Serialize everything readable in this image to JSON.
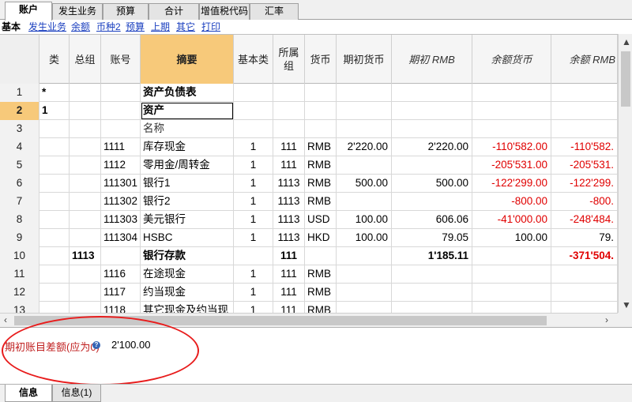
{
  "tabs": [
    "账户",
    "发生业务",
    "预算",
    "合计",
    "增值税代码",
    "汇率"
  ],
  "subnav": {
    "current": "基本",
    "links": [
      "发生业务",
      "余额",
      "币种2",
      "预算",
      "上期",
      "其它",
      "打印"
    ]
  },
  "columns": [
    "",
    "类",
    "总组",
    "账号",
    "摘要",
    "基本类",
    "所属\n组",
    "货币",
    "期初货币",
    "期初 RMB",
    "余额货币",
    "余额 RMB"
  ],
  "rows": [
    {
      "n": "1",
      "cls": "*",
      "grp": "",
      "acct": "",
      "desc": "资产负债表",
      "bc": "",
      "bg": "",
      "cur": "",
      "ob": "",
      "obr": "",
      "bal": "",
      "balr": ""
    },
    {
      "n": "2",
      "cls": "1",
      "grp": "",
      "acct": "",
      "desc": "资产",
      "bc": "",
      "bg": "",
      "cur": "",
      "ob": "",
      "obr": "",
      "bal": "",
      "balr": ""
    },
    {
      "n": "3",
      "cls": "",
      "grp": "",
      "acct": "",
      "desc": "名称",
      "bc": "",
      "bg": "",
      "cur": "",
      "ob": "",
      "obr": "",
      "bal": "",
      "balr": ""
    },
    {
      "n": "4",
      "cls": "",
      "grp": "",
      "acct": "1111",
      "desc": "库存现金",
      "bc": "1",
      "bg": "111",
      "cur": "RMB",
      "ob": "2'220.00",
      "obr": "2'220.00",
      "bal": "-110'582.00",
      "balr": "-110'582."
    },
    {
      "n": "5",
      "cls": "",
      "grp": "",
      "acct": "1112",
      "desc": "零用金/周转金",
      "bc": "1",
      "bg": "111",
      "cur": "RMB",
      "ob": "",
      "obr": "",
      "bal": "-205'531.00",
      "balr": "-205'531."
    },
    {
      "n": "6",
      "cls": "",
      "grp": "",
      "acct": "111301",
      "desc": "银行1",
      "bc": "1",
      "bg": "1113",
      "cur": "RMB",
      "ob": "500.00",
      "obr": "500.00",
      "bal": "-122'299.00",
      "balr": "-122'299."
    },
    {
      "n": "7",
      "cls": "",
      "grp": "",
      "acct": "111302",
      "desc": "银行2",
      "bc": "1",
      "bg": "1113",
      "cur": "RMB",
      "ob": "",
      "obr": "",
      "bal": "-800.00",
      "balr": "-800."
    },
    {
      "n": "8",
      "cls": "",
      "grp": "",
      "acct": "111303",
      "desc": "美元银行",
      "bc": "1",
      "bg": "1113",
      "cur": "USD",
      "ob": "100.00",
      "obr": "606.06",
      "bal": "-41'000.00",
      "balr": "-248'484."
    },
    {
      "n": "9",
      "cls": "",
      "grp": "",
      "acct": "111304",
      "desc": "HSBC",
      "bc": "1",
      "bg": "1113",
      "cur": "HKD",
      "ob": "100.00",
      "obr": "79.05",
      "bal": "100.00",
      "balr": "79."
    },
    {
      "n": "10",
      "cls": "",
      "grp": "1113",
      "acct": "",
      "desc": "银行存款",
      "bc": "",
      "bg": "111",
      "cur": "",
      "ob": "",
      "obr": "1'185.11",
      "bal": "",
      "balr": "-371'504."
    },
    {
      "n": "11",
      "cls": "",
      "grp": "",
      "acct": "1116",
      "desc": "在途现金",
      "bc": "1",
      "bg": "111",
      "cur": "RMB",
      "ob": "",
      "obr": "",
      "bal": "",
      "balr": ""
    },
    {
      "n": "12",
      "cls": "",
      "grp": "",
      "acct": "1117",
      "desc": "约当现金",
      "bc": "1",
      "bg": "111",
      "cur": "RMB",
      "ob": "",
      "obr": "",
      "bal": "",
      "balr": ""
    },
    {
      "n": "13",
      "cls": "",
      "grp": "",
      "acct": "1118",
      "desc": "其它现金及约当现",
      "bc": "1",
      "bg": "111",
      "cur": "RMB",
      "ob": "",
      "obr": "",
      "bal": "",
      "balr": ""
    }
  ],
  "info": {
    "label": "期初账目差额(应为0)",
    "help_icon": "?",
    "value": "2'100.00"
  },
  "bottom_tabs": [
    "信息",
    "信息(1)"
  ],
  "colors": {
    "summary_header": "#f7c97a",
    "negative": "#e00000",
    "annotation": "#e81c1c",
    "link": "#1a3fbf"
  }
}
